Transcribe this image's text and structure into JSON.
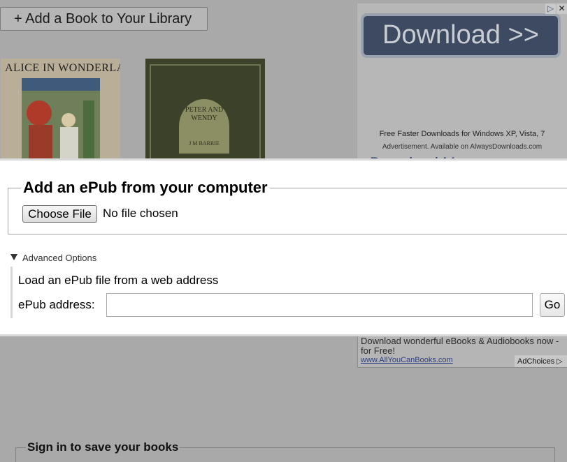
{
  "background": {
    "add_book_button": "+ Add a Book to Your Library",
    "books": [
      {
        "title": "ALICE IN WONDERLAND"
      },
      {
        "title": "PETER AND WENDY",
        "author": "J M BARRIE"
      }
    ],
    "ad_top": {
      "button_label": "Download >>",
      "line1": "Free Faster Downloads for Windows XP, Vista, 7",
      "line2": "Advertisement. Available on AlwaysDownloads.com",
      "cut_text": "Download M..."
    },
    "ad_bottom": {
      "text": "Download wonderful eBooks & Audiobooks now - for Free!",
      "link": "www.AllYouCanBooks.com",
      "adchoices": "AdChoices ▷"
    },
    "signin_legend": "Sign in to save your books"
  },
  "modal": {
    "legend": "Add an ePub from your computer",
    "choose_file_label": "Choose File",
    "no_file_text": "No file chosen",
    "advanced_label": "Advanced Options",
    "load_label": "Load an ePub file from a web address",
    "address_label": "ePub address:",
    "address_value": "",
    "go_label": "Go"
  },
  "colors": {
    "overlay_gray": "#a9a9a9",
    "modal_bg": "#ffffff",
    "ad_button": "#3d4a62"
  }
}
